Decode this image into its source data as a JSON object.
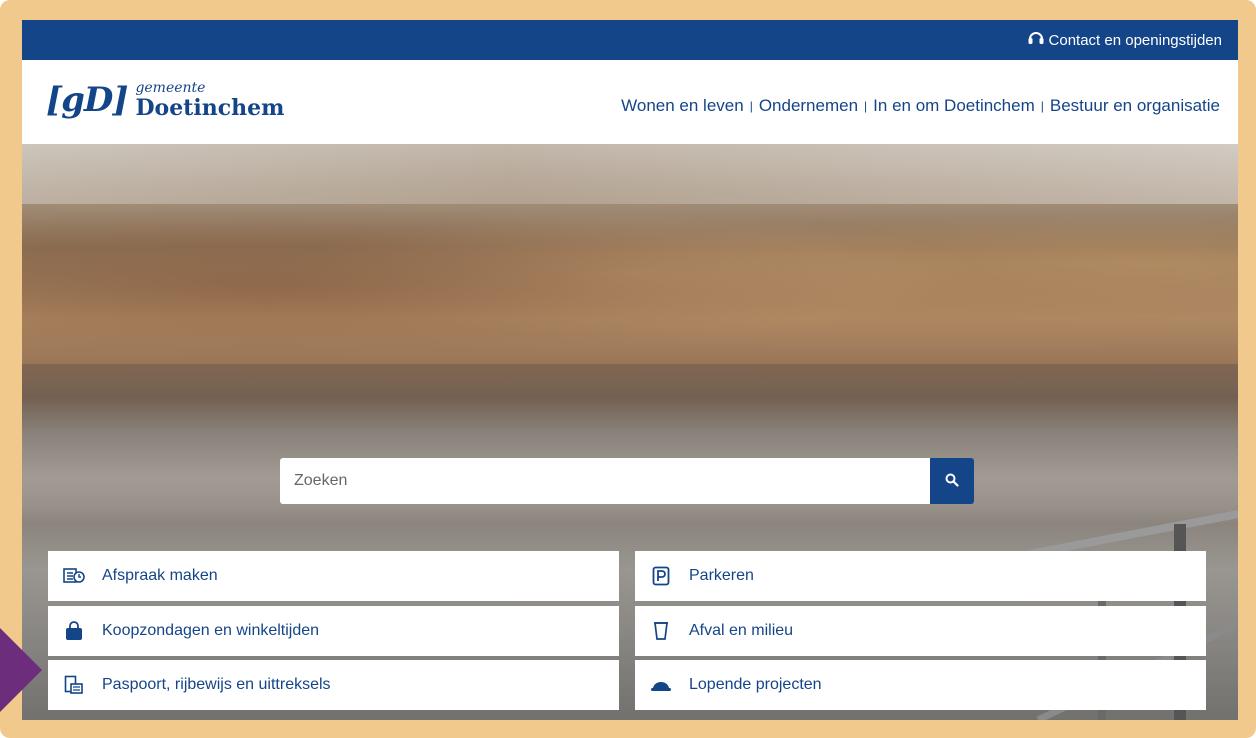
{
  "topbar": {
    "contact_label": "Contact en openingstijden",
    "contact_icon": "headset-icon"
  },
  "logo": {
    "mark": "[gD]",
    "small": "gemeente",
    "big": "Doetinchem"
  },
  "nav": [
    {
      "label": "Wonen en leven"
    },
    {
      "label": "Ondernemen"
    },
    {
      "label": "In en om Doetinchem"
    },
    {
      "label": "Bestuur en organisatie"
    }
  ],
  "search": {
    "placeholder": "Zoeken",
    "icon": "search-icon"
  },
  "tiles": [
    {
      "label": "Afspraak maken",
      "icon": "calendar-clock-icon"
    },
    {
      "label": "Parkeren",
      "icon": "parking-icon"
    },
    {
      "label": "Koopzondagen en winkeltijden",
      "icon": "shopping-bag-icon"
    },
    {
      "label": "Afval en milieu",
      "icon": "waste-bin-icon"
    },
    {
      "label": "Paspoort, rijbewijs en uittreksels",
      "icon": "passport-icon"
    },
    {
      "label": "Lopende projecten",
      "icon": "hard-hat-icon"
    }
  ],
  "colors": {
    "brand": "#154589",
    "frame": "#f2c98c",
    "arrow": "#6b2d7c"
  }
}
